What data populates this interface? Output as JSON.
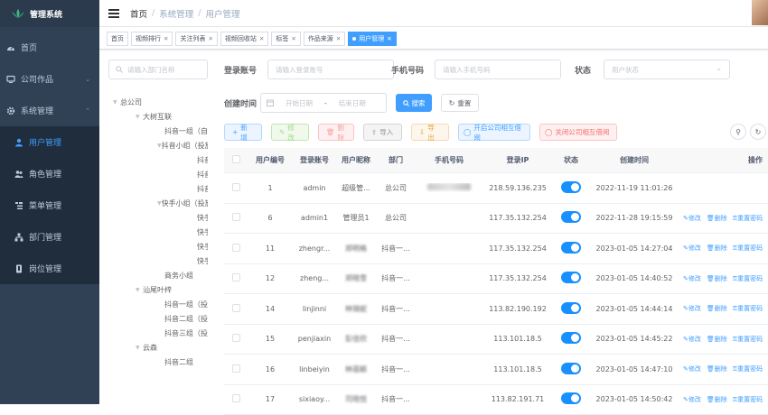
{
  "app": {
    "title": "管理系统"
  },
  "sidebar": {
    "items": [
      {
        "label": "首页",
        "icon": "dashboard-icon"
      },
      {
        "label": "公司作品",
        "icon": "monitor-icon"
      },
      {
        "label": "系统管理",
        "icon": "gear-icon"
      }
    ],
    "subitems": [
      {
        "label": "用户管理",
        "icon": "user-icon"
      },
      {
        "label": "角色管理",
        "icon": "peoples-icon"
      },
      {
        "label": "菜单管理",
        "icon": "tree-table-icon"
      },
      {
        "label": "部门管理",
        "icon": "tree-icon"
      },
      {
        "label": "岗位管理",
        "icon": "post-icon"
      }
    ]
  },
  "breadcrumb": [
    "首页",
    "系统管理",
    "用户管理"
  ],
  "tags": [
    {
      "label": "首页",
      "closable": false
    },
    {
      "label": "视频排行",
      "closable": true
    },
    {
      "label": "关注列表",
      "closable": true
    },
    {
      "label": "视频回收站",
      "closable": true
    },
    {
      "label": "标签",
      "closable": true
    },
    {
      "label": "作品来源",
      "closable": true
    },
    {
      "label": "用户管理",
      "closable": true,
      "active": true
    }
  ],
  "tree": {
    "search_placeholder": "请输入部门名称",
    "nodes": [
      {
        "label": "总公司",
        "level": 0,
        "caret": true
      },
      {
        "label": "大树互联",
        "level": 1,
        "caret": true
      },
      {
        "label": "抖音一组（自运营）",
        "level": 2,
        "caret": false
      },
      {
        "label": "抖音小组（投放）",
        "level": 2,
        "caret": true
      },
      {
        "label": "抖音二组（投放）",
        "level": 3,
        "caret": false
      },
      {
        "label": "抖音三组（投放）",
        "level": 3,
        "caret": false
      },
      {
        "label": "抖音四组（投放）",
        "level": 3,
        "caret": false
      },
      {
        "label": "快手小组（投放）",
        "level": 2,
        "caret": true
      },
      {
        "label": "快手一组（投放）",
        "level": 3,
        "caret": false
      },
      {
        "label": "快手二组（投放）",
        "level": 3,
        "caret": false
      },
      {
        "label": "快手三组（投放）",
        "level": 3,
        "caret": false
      },
      {
        "label": "快手四组（投放）",
        "level": 3,
        "caret": false
      },
      {
        "label": "商务小组",
        "level": 2,
        "caret": false
      },
      {
        "label": "汕尾叶梓",
        "level": 1,
        "caret": true
      },
      {
        "label": "抖音一组（投放）",
        "level": 2,
        "caret": false
      },
      {
        "label": "抖音二组（投放）",
        "level": 2,
        "caret": false
      },
      {
        "label": "抖音三组（投放）",
        "level": 2,
        "caret": false
      },
      {
        "label": "云森",
        "level": 1,
        "caret": true
      },
      {
        "label": "抖音二组",
        "level": 2,
        "caret": false
      }
    ]
  },
  "form": {
    "account_label": "登录账号",
    "account_placeholder": "请输入登录账号",
    "phone_label": "手机号码",
    "phone_placeholder": "请输入手机号码",
    "status_label": "状态",
    "status_placeholder": "用户状态",
    "time_label": "创建时间",
    "start_placeholder": "开始日期",
    "date_sep": "-",
    "end_placeholder": "结束日期",
    "search_label": "搜索",
    "reset_label": "重置"
  },
  "toolbar": {
    "add": "新增",
    "edit": "修改",
    "delete": "删除",
    "import": "导入",
    "export": "导出",
    "enable_related": "开启公司相互借阅",
    "disable_related": "关闭公司相互借阅"
  },
  "table": {
    "headers": [
      "用户编号",
      "登录账号",
      "用户昵称",
      "部门",
      "手机号码",
      "登录IP",
      "状态",
      "创建时间",
      "操作"
    ],
    "op_labels": [
      "修改",
      "删除",
      "重置密码"
    ],
    "rows": [
      {
        "id": "1",
        "account": "admin",
        "nick": "超级管...",
        "dept": "总公司",
        "ip": "218.59.136.235",
        "status": true,
        "time": "2022-11-19 11:01:26",
        "ops": false
      },
      {
        "id": "6",
        "account": "admin1",
        "nick": "管理员1",
        "dept": "总公司",
        "ip": "117.35.132.254",
        "status": true,
        "time": "2022-11-28 19:15:59",
        "ops": true
      },
      {
        "id": "11",
        "account": "zhengr...",
        "nick": "郑明格",
        "dept": "抖音一...",
        "ip": "117.35.132.254",
        "status": true,
        "time": "2023-01-05 14:27:04",
        "ops": true
      },
      {
        "id": "12",
        "account": "zheng...",
        "nick": "郑晓雪",
        "dept": "抖音一...",
        "ip": "117.35.132.254",
        "status": true,
        "time": "2023-01-05 14:40:52",
        "ops": true
      },
      {
        "id": "14",
        "account": "linjinni",
        "nick": "林锦妮",
        "dept": "抖音一...",
        "ip": "113.82.190.192",
        "status": true,
        "time": "2023-01-05 14:44:14",
        "ops": true
      },
      {
        "id": "15",
        "account": "penjiaxin",
        "nick": "彭佳欣",
        "dept": "抖音一...",
        "ip": "113.101.18.5",
        "status": true,
        "time": "2023-01-05 14:45:22",
        "ops": true
      },
      {
        "id": "16",
        "account": "linbeiyin",
        "nick": "林蓓颖",
        "dept": "抖音一...",
        "ip": "113.101.18.5",
        "status": true,
        "time": "2023-01-05 14:47:10",
        "ops": true
      },
      {
        "id": "17",
        "account": "sixiaoy...",
        "nick": "司晓悦",
        "dept": "抖音一...",
        "ip": "113.82.191.71",
        "status": true,
        "time": "2023-01-05 14:50:42",
        "ops": true
      }
    ]
  },
  "colors": {
    "sidebar": "#304156",
    "accent": "#409eff",
    "switch_on": "#1890ff"
  }
}
